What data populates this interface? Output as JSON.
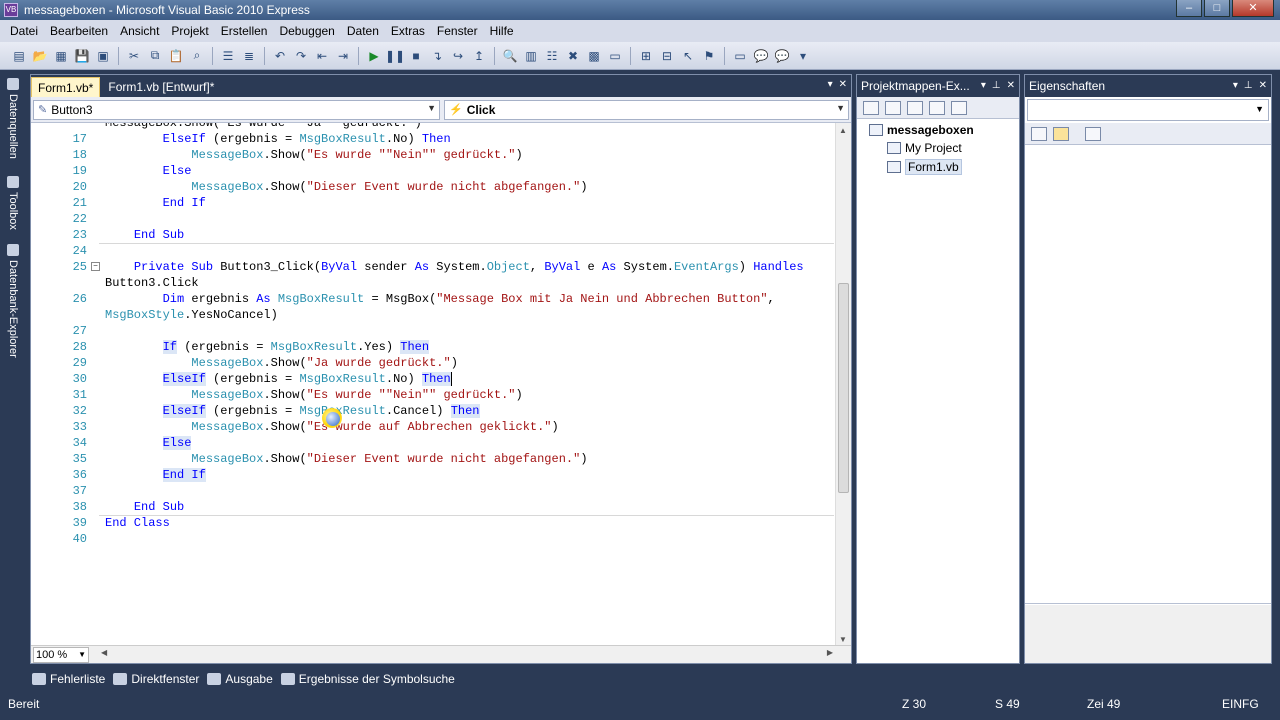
{
  "window": {
    "title": "messageboxen - Microsoft Visual Basic 2010 Express",
    "app_icon_text": "VB"
  },
  "menu": [
    "Datei",
    "Bearbeiten",
    "Ansicht",
    "Projekt",
    "Erstellen",
    "Debuggen",
    "Daten",
    "Extras",
    "Fenster",
    "Hilfe"
  ],
  "left_tabs": [
    "Datenquellen",
    "Toolbox",
    "Datenbank-Explorer"
  ],
  "doc_tabs": [
    {
      "label": "Form1.vb*",
      "active": true
    },
    {
      "label": "Form1.vb [Entwurf]*",
      "active": false
    }
  ],
  "nav": {
    "object": "Button3",
    "event": "Click"
  },
  "code_lines": [
    {
      "n": "",
      "tokens": [
        {
          "t": "MessageBox.Show(\"Es wurde \"\"Ja\"\" gedrückt.\")",
          "c": ""
        }
      ]
    },
    {
      "n": "17",
      "tokens": [
        {
          "t": "        ",
          "c": ""
        },
        {
          "t": "ElseIf",
          "c": "kw"
        },
        {
          "t": " (ergebnis = ",
          "c": ""
        },
        {
          "t": "MsgBoxResult",
          "c": "typ"
        },
        {
          "t": ".No) ",
          "c": ""
        },
        {
          "t": "Then",
          "c": "kw"
        }
      ]
    },
    {
      "n": "18",
      "tokens": [
        {
          "t": "            ",
          "c": ""
        },
        {
          "t": "MessageBox",
          "c": "typ"
        },
        {
          "t": ".Show(",
          "c": ""
        },
        {
          "t": "\"Es wurde \"\"Nein\"\" gedrückt.\"",
          "c": "str"
        },
        {
          "t": ")",
          "c": ""
        }
      ]
    },
    {
      "n": "19",
      "tokens": [
        {
          "t": "        ",
          "c": ""
        },
        {
          "t": "Else",
          "c": "kw"
        }
      ]
    },
    {
      "n": "20",
      "tokens": [
        {
          "t": "            ",
          "c": ""
        },
        {
          "t": "MessageBox",
          "c": "typ"
        },
        {
          "t": ".Show(",
          "c": ""
        },
        {
          "t": "\"Dieser Event wurde nicht abgefangen.\"",
          "c": "str"
        },
        {
          "t": ")",
          "c": ""
        }
      ]
    },
    {
      "n": "21",
      "tokens": [
        {
          "t": "        ",
          "c": ""
        },
        {
          "t": "End If",
          "c": "kw"
        }
      ]
    },
    {
      "n": "22",
      "tokens": []
    },
    {
      "n": "23",
      "tokens": [
        {
          "t": "    ",
          "c": ""
        },
        {
          "t": "End Sub",
          "c": "kw"
        }
      ]
    },
    {
      "n": "24",
      "tokens": []
    },
    {
      "n": "25",
      "collapse": true,
      "tokens": [
        {
          "t": "    ",
          "c": ""
        },
        {
          "t": "Private Sub",
          "c": "kw"
        },
        {
          "t": " Button3_Click(",
          "c": ""
        },
        {
          "t": "ByVal",
          "c": "kw"
        },
        {
          "t": " sender ",
          "c": ""
        },
        {
          "t": "As",
          "c": "kw"
        },
        {
          "t": " System.",
          "c": ""
        },
        {
          "t": "Object",
          "c": "typ"
        },
        {
          "t": ", ",
          "c": ""
        },
        {
          "t": "ByVal",
          "c": "kw"
        },
        {
          "t": " e ",
          "c": ""
        },
        {
          "t": "As",
          "c": "kw"
        },
        {
          "t": " System.",
          "c": ""
        },
        {
          "t": "EventArgs",
          "c": "typ"
        },
        {
          "t": ") ",
          "c": ""
        },
        {
          "t": "Handles",
          "c": "kw"
        }
      ]
    },
    {
      "n": "",
      "tokens": [
        {
          "t": "Button3.Click",
          "c": ""
        }
      ]
    },
    {
      "n": "26",
      "tokens": [
        {
          "t": "        ",
          "c": ""
        },
        {
          "t": "Dim",
          "c": "kw"
        },
        {
          "t": " ergebnis ",
          "c": ""
        },
        {
          "t": "As",
          "c": "kw"
        },
        {
          "t": " ",
          "c": ""
        },
        {
          "t": "MsgBoxResult",
          "c": "typ"
        },
        {
          "t": " = MsgBox(",
          "c": ""
        },
        {
          "t": "\"Message Box mit Ja Nein und Abbrechen Button\"",
          "c": "str"
        },
        {
          "t": ",",
          "c": ""
        }
      ]
    },
    {
      "n": "",
      "tokens": [
        {
          "t": "MsgBoxStyle",
          "c": "typ"
        },
        {
          "t": ".YesNoCancel)",
          "c": ""
        }
      ]
    },
    {
      "n": "27",
      "tokens": []
    },
    {
      "n": "28",
      "tokens": [
        {
          "t": "        ",
          "c": ""
        },
        {
          "t": "If",
          "c": "kw hl"
        },
        {
          "t": " (ergebnis = ",
          "c": ""
        },
        {
          "t": "MsgBoxResult",
          "c": "typ"
        },
        {
          "t": ".Yes) ",
          "c": ""
        },
        {
          "t": "Then",
          "c": "kw hl"
        }
      ]
    },
    {
      "n": "29",
      "tokens": [
        {
          "t": "            ",
          "c": ""
        },
        {
          "t": "MessageBox",
          "c": "typ"
        },
        {
          "t": ".Show(",
          "c": ""
        },
        {
          "t": "\"Ja wurde gedrückt.\"",
          "c": "str"
        },
        {
          "t": ")",
          "c": ""
        }
      ]
    },
    {
      "n": "30",
      "tokens": [
        {
          "t": "        ",
          "c": ""
        },
        {
          "t": "ElseIf",
          "c": "kw hl"
        },
        {
          "t": " (ergebnis = ",
          "c": ""
        },
        {
          "t": "MsgBoxResult",
          "c": "typ"
        },
        {
          "t": ".No) ",
          "c": ""
        },
        {
          "t": "Then",
          "c": "kw hl"
        }
      ],
      "cursor": true
    },
    {
      "n": "31",
      "tokens": [
        {
          "t": "            ",
          "c": ""
        },
        {
          "t": "MessageBox",
          "c": "typ"
        },
        {
          "t": ".Show(",
          "c": ""
        },
        {
          "t": "\"Es wurde \"\"Nein\"\" gedrückt.\"",
          "c": "str"
        },
        {
          "t": ")",
          "c": ""
        }
      ]
    },
    {
      "n": "32",
      "tokens": [
        {
          "t": "        ",
          "c": ""
        },
        {
          "t": "ElseIf",
          "c": "kw hl"
        },
        {
          "t": " (ergebnis = ",
          "c": ""
        },
        {
          "t": "MsgBoxResult",
          "c": "typ"
        },
        {
          "t": ".Cancel) ",
          "c": ""
        },
        {
          "t": "Then",
          "c": "kw hl"
        }
      ]
    },
    {
      "n": "33",
      "tokens": [
        {
          "t": "            ",
          "c": ""
        },
        {
          "t": "MessageBox",
          "c": "typ"
        },
        {
          "t": ".Show(",
          "c": ""
        },
        {
          "t": "\"Es wurde auf Abbrechen geklickt.\"",
          "c": "str"
        },
        {
          "t": ")",
          "c": ""
        }
      ]
    },
    {
      "n": "34",
      "tokens": [
        {
          "t": "        ",
          "c": ""
        },
        {
          "t": "Else",
          "c": "kw hl"
        }
      ]
    },
    {
      "n": "35",
      "tokens": [
        {
          "t": "            ",
          "c": ""
        },
        {
          "t": "MessageBox",
          "c": "typ"
        },
        {
          "t": ".Show(",
          "c": ""
        },
        {
          "t": "\"Dieser Event wurde nicht abgefangen.\"",
          "c": "str"
        },
        {
          "t": ")",
          "c": ""
        }
      ]
    },
    {
      "n": "36",
      "tokens": [
        {
          "t": "        ",
          "c": ""
        },
        {
          "t": "End If",
          "c": "kw hl"
        }
      ]
    },
    {
      "n": "37",
      "tokens": []
    },
    {
      "n": "38",
      "tokens": [
        {
          "t": "    ",
          "c": ""
        },
        {
          "t": "End Sub",
          "c": "kw"
        }
      ]
    },
    {
      "n": "39",
      "tokens": [
        {
          "t": "End Class",
          "c": "kw"
        }
      ]
    },
    {
      "n": "40",
      "tokens": []
    }
  ],
  "editor": {
    "zoom": "100 %"
  },
  "solution_explorer": {
    "title": "Projektmappen-Ex...",
    "items": [
      {
        "label": "messageboxen",
        "bold": true
      },
      {
        "label": "My Project"
      },
      {
        "label": "Form1.vb",
        "selected": true
      }
    ]
  },
  "properties": {
    "title": "Eigenschaften"
  },
  "output_tabs": [
    "Fehlerliste",
    "Direktfenster",
    "Ausgabe",
    "Ergebnisse der Symbolsuche"
  ],
  "status": {
    "ready": "Bereit",
    "line": "Z 30",
    "col": "S 49",
    "char": "Zei 49",
    "mode": "EINFG"
  }
}
